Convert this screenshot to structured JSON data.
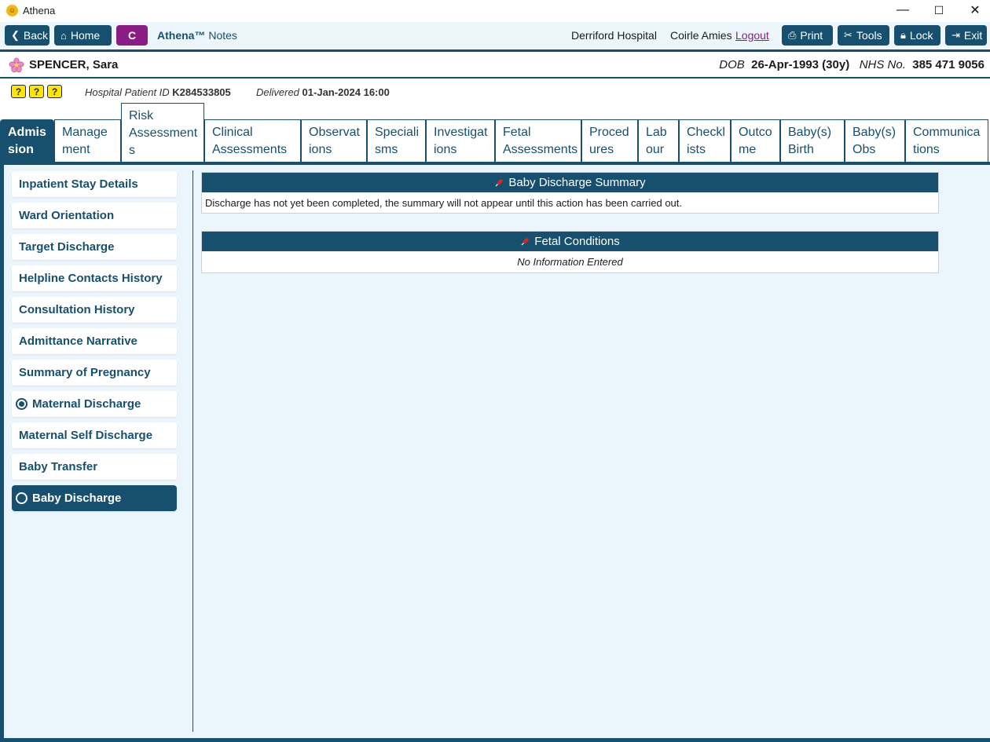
{
  "window": {
    "title": "Athena",
    "minimize": "—",
    "maximize": "☐",
    "close": "✕"
  },
  "toolbar": {
    "back": "Back",
    "home": "Home",
    "c_button": "C",
    "brand": "Athena™",
    "brand_suffix": "Notes",
    "hospital": "Derriford Hospital",
    "user": "Coirle Amies",
    "logout": "Logout",
    "print": "Print",
    "tools": "Tools",
    "lock": "Lock",
    "exit": "Exit"
  },
  "patient": {
    "name": "SPENCER, Sara",
    "dob_label": "DOB",
    "dob": "26-Apr-1993 (30y)",
    "nhs_label": "NHS No.",
    "nhs": "385 471 9056",
    "hospital_id_label": "Hospital Patient ID",
    "hospital_id": "K284533805",
    "delivered_label": "Delivered",
    "delivered": "01-Jan-2024 16:00",
    "alerts": [
      "?",
      "?",
      "?"
    ]
  },
  "tabs": [
    {
      "line1": "Admis",
      "line2": "sion"
    },
    {
      "line1": "Manage",
      "line2": "ment"
    },
    {
      "line1": "Risk",
      "line2": "Assessment",
      "line3": "s"
    },
    {
      "line1": "Clinical",
      "line2": "Assessments"
    },
    {
      "line1": "Observat",
      "line2": "ions"
    },
    {
      "line1": "Speciali",
      "line2": "sms"
    },
    {
      "line1": "Investigat",
      "line2": "ions"
    },
    {
      "line1": "Fetal",
      "line2": "Assessments"
    },
    {
      "line1": "Proced",
      "line2": "ures"
    },
    {
      "line1": "Lab",
      "line2": "our"
    },
    {
      "line1": "Checkl",
      "line2": "ists"
    },
    {
      "line1": "Outco",
      "line2": "me"
    },
    {
      "line1": "Baby(s)",
      "line2": "Birth"
    },
    {
      "line1": "Baby(s)",
      "line2": "Obs"
    },
    {
      "line1": "Communica",
      "line2": "tions"
    }
  ],
  "sidebar": {
    "items": [
      {
        "label": "Inpatient Stay Details"
      },
      {
        "label": "Ward Orientation"
      },
      {
        "label": "Target Discharge"
      },
      {
        "label": "Helpline Contacts History"
      },
      {
        "label": "Consultation History"
      },
      {
        "label": "Admittance Narrative"
      },
      {
        "label": "Summary of Pregnancy"
      },
      {
        "label": "Maternal Discharge"
      },
      {
        "label": "Maternal Self Discharge"
      },
      {
        "label": "Baby Transfer"
      },
      {
        "label": "Baby Discharge"
      }
    ]
  },
  "main": {
    "panels": [
      {
        "title": "Baby Discharge Summary",
        "body": "Discharge has not yet been completed, the summary will not appear until this action has been carried out."
      },
      {
        "title": "Fetal Conditions",
        "body": "No Information Entered"
      }
    ]
  },
  "colors": {
    "primary": "#17506f",
    "accent": "#8a1d84",
    "background": "#ebf6fc",
    "alert": "#ffe600"
  }
}
